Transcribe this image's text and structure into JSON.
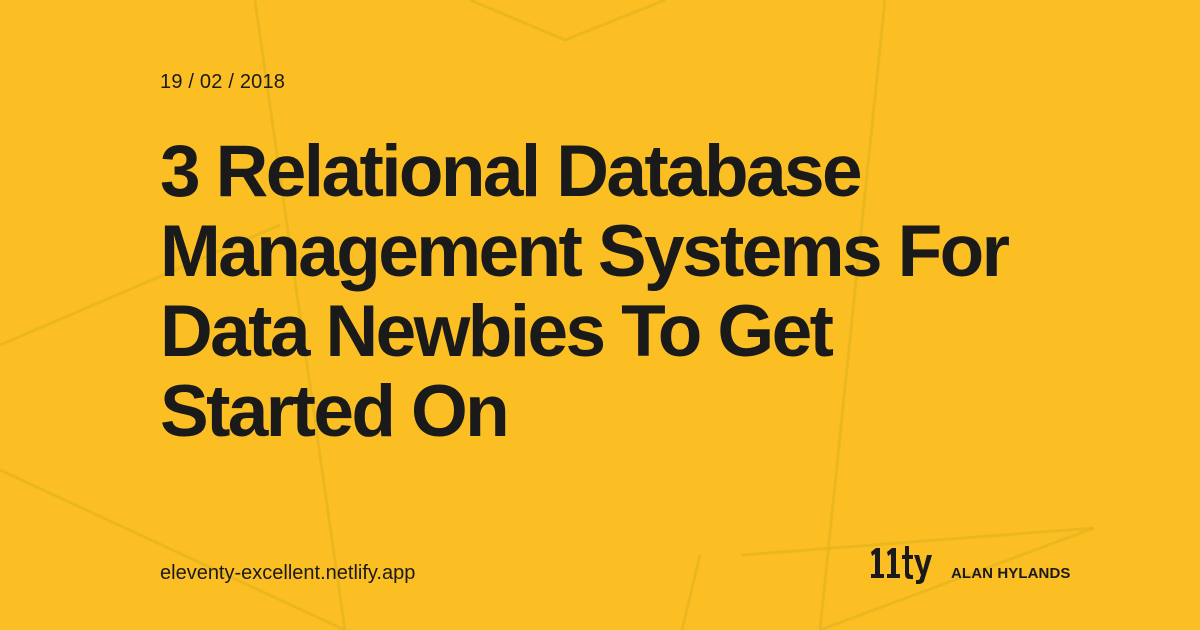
{
  "post": {
    "date": "19 / 02 / 2018",
    "title_lines": [
      "3 Relational Database",
      "Management Systems For",
      "Data Newbies To Get",
      "Started On"
    ]
  },
  "footer": {
    "site_url": "eleventy-excellent.netlify.app",
    "logo_text": "11ty",
    "author": "ALAN HYLANDS"
  },
  "colors": {
    "background": "#FBBF24",
    "text": "#1a1a1a",
    "decorative_line": "#E8B51F"
  },
  "icons": {
    "logo": "eleventy-logo"
  }
}
